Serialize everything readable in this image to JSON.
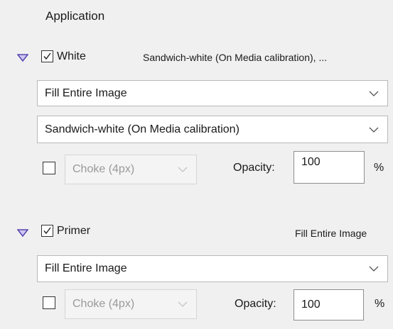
{
  "panel": {
    "heading": "Application"
  },
  "white_section": {
    "title": "White",
    "checked": true,
    "summary": "Sandwich-white (On Media calibration), ...",
    "fill_select": "Fill Entire Image",
    "profile_select": "Sandwich-white (On Media calibration)",
    "choke_checked": false,
    "choke_select": "Choke (4px)",
    "opacity_label": "Opacity:",
    "opacity_value": "100",
    "percent": "%"
  },
  "primer_section": {
    "title": "Primer",
    "checked": true,
    "summary": "Fill Entire Image",
    "fill_select": "Fill Entire Image",
    "choke_checked": false,
    "choke_select": "Choke (4px)",
    "opacity_label": "Opacity:",
    "opacity_value": "100",
    "percent": "%"
  },
  "colors": {
    "triangle": "#5b46b3",
    "background": "#f0f0f0"
  },
  "icons": [
    "collapse-triangle-icon",
    "checkmark-icon",
    "chevron-down-icon"
  ]
}
